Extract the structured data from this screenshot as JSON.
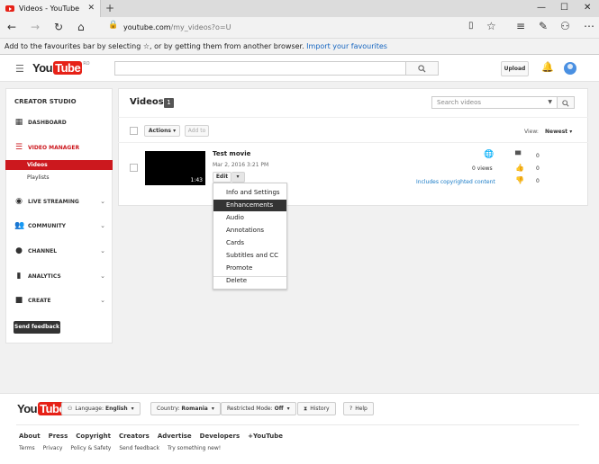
{
  "browser": {
    "tab_title": "Videos - YouTube",
    "url_host": "youtube.com",
    "url_path": "/my_videos?o=U",
    "favbar_text": "Add to the favourites bar by selecting ☆, or by getting them from another browser.",
    "favbar_link": "Import your favourites"
  },
  "header": {
    "logo_you": "You",
    "logo_tube": "Tube",
    "logo_region": "RO",
    "upload_label": "Upload"
  },
  "sidebar": {
    "title": "CREATOR STUDIO",
    "dashboard": "DASHBOARD",
    "video_manager": "VIDEO MANAGER",
    "videos": "Videos",
    "playlists": "Playlists",
    "live_streaming": "LIVE STREAMING",
    "community": "COMMUNITY",
    "channel": "CHANNEL",
    "analytics": "ANALYTICS",
    "create": "CREATE",
    "send_feedback": "Send feedback"
  },
  "main": {
    "title": "Videos",
    "count": "1",
    "search_placeholder": "Search videos",
    "actions_label": "Actions",
    "add_to_label": "Add to",
    "view_label": "View:",
    "view_value": "Newest",
    "video": {
      "title": "Test movie",
      "date": "Mar 2, 2016 3:21 PM",
      "duration": "1:43",
      "edit_label": "Edit",
      "views": "0 views",
      "copyright": "Includes copyrighted content",
      "comments": "0",
      "likes": "0",
      "dislikes": "0"
    },
    "menu": {
      "items": [
        "Info and Settings",
        "Enhancements",
        "Audio",
        "Annotations",
        "Cards",
        "Subtitles and CC",
        "Promote"
      ],
      "delete": "Delete",
      "active_index": 1
    }
  },
  "footer": {
    "language_label": "Language:",
    "language_value": "English",
    "country_label": "Country:",
    "country_value": "Romania",
    "restricted_label": "Restricted Mode:",
    "restricted_value": "Off",
    "history": "History",
    "help": "Help",
    "links": [
      "About",
      "Press",
      "Copyright",
      "Creators",
      "Advertise",
      "Developers",
      "+YouTube"
    ],
    "links2": [
      "Terms",
      "Privacy",
      "Policy & Safety",
      "Send feedback",
      "Try something new!"
    ]
  },
  "colors": {
    "accent_red": "#cc181e",
    "link_blue": "#167ac6"
  }
}
